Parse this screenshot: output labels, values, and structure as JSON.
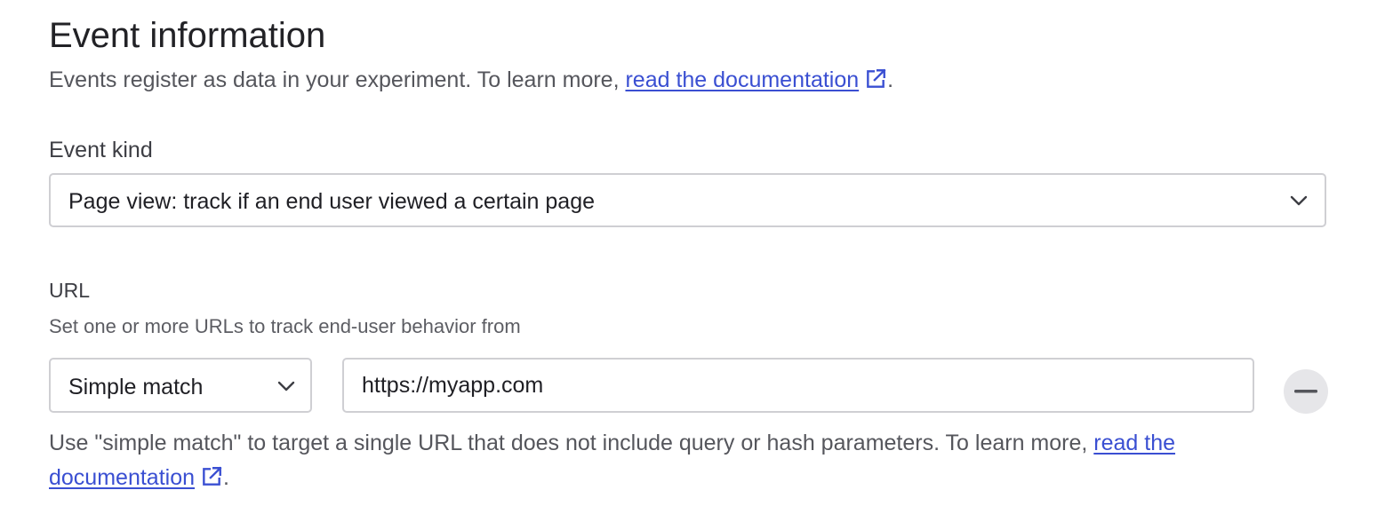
{
  "section": {
    "title": "Event information",
    "subtitle_prefix": "Events register as data in your experiment. To learn more, ",
    "subtitle_link": "read the documentation",
    "subtitle_suffix": "."
  },
  "event_kind": {
    "label": "Event kind",
    "selected": "Page view: track if an end user viewed a certain page"
  },
  "url": {
    "label": "URL",
    "hint": "Set one or more URLs to track end-user behavior from",
    "match_type": "Simple match",
    "value": "https://myapp.com",
    "help_prefix": "Use \"simple match\" to target a single URL that does not include query or hash parameters. To learn more, ",
    "help_link": "read the documentation",
    "help_suffix": "."
  },
  "icons": {
    "external_link": "external-link-icon",
    "chevron": "chevron-down-icon",
    "remove": "minus-icon"
  },
  "colors": {
    "link": "#3a4fd2",
    "border": "#cfcfd3",
    "remove_button_bg": "#e6e6e9"
  }
}
